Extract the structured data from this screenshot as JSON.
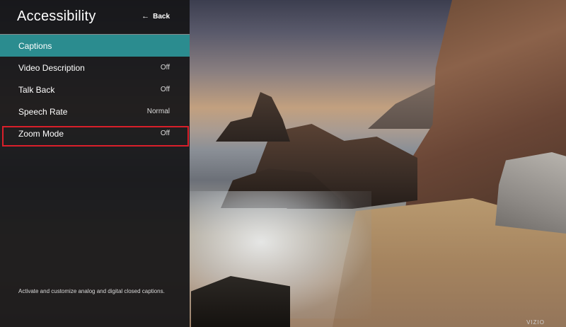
{
  "panel": {
    "title": "Accessibility",
    "back_label": "Back",
    "accent_color": "#2b8c8f",
    "highlight_color": "#d91f2a",
    "items": [
      {
        "label": "Captions",
        "value": ""
      },
      {
        "label": "Video Description",
        "value": "Off"
      },
      {
        "label": "Talk Back",
        "value": "Off"
      },
      {
        "label": "Speech Rate",
        "value": "Normal"
      },
      {
        "label": "Zoom Mode",
        "value": "Off"
      }
    ],
    "description": "Activate and customize analog and digital closed captions."
  },
  "brand": "VIZIO",
  "icons": {
    "back": "back-arrow-icon"
  }
}
